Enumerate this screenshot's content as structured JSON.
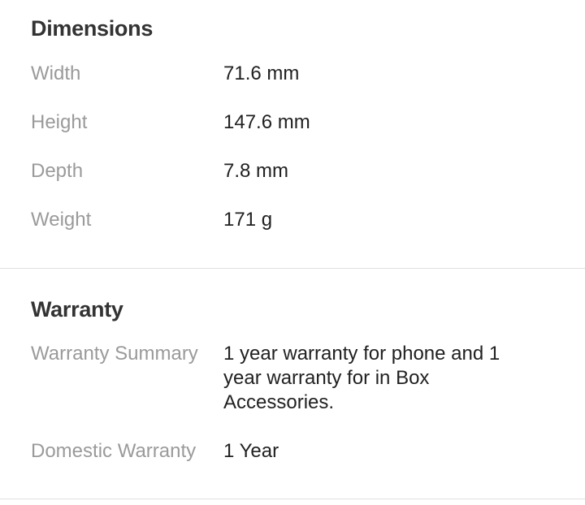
{
  "dimensions": {
    "title": "Dimensions",
    "rows": [
      {
        "label": "Width",
        "value": "71.6 mm"
      },
      {
        "label": "Height",
        "value": "147.6 mm"
      },
      {
        "label": "Depth",
        "value": "7.8 mm"
      },
      {
        "label": "Weight",
        "value": "171 g"
      }
    ]
  },
  "warranty": {
    "title": "Warranty",
    "rows": [
      {
        "label": "Warranty Summary",
        "value": "1 year warranty for phone and 1 year warranty for in Box Accessories."
      },
      {
        "label": "Domestic Warranty",
        "value": "1 Year"
      }
    ]
  }
}
